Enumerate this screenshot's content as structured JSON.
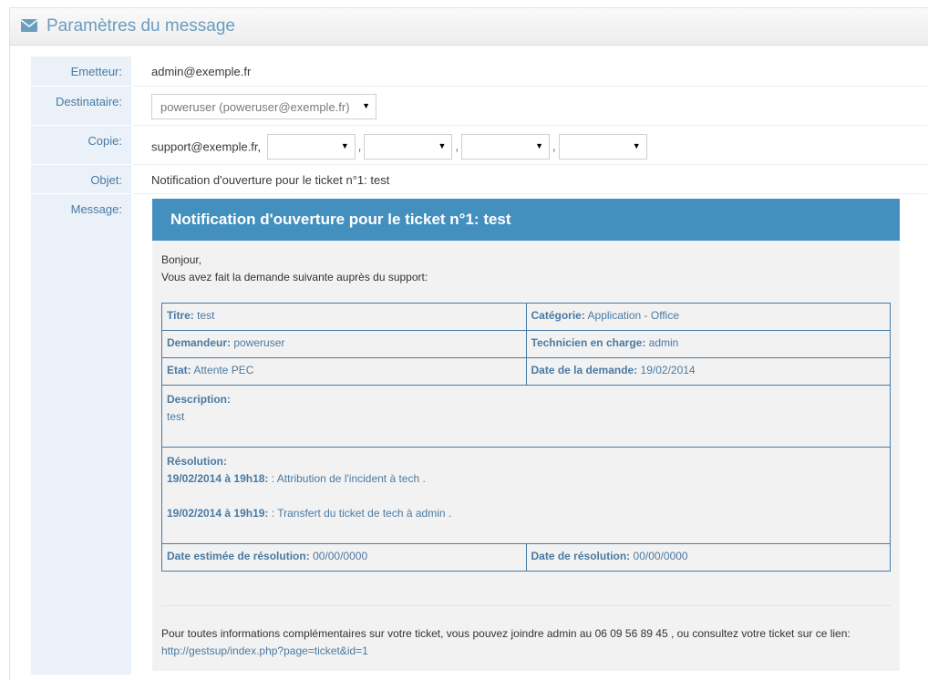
{
  "header": {
    "title": "Paramètres du message",
    "icon": "envelope-icon"
  },
  "form": {
    "sender_label": "Emetteur:",
    "sender_value": "admin@exemple.fr",
    "recipient_label": "Destinataire:",
    "recipient_value": "poweruser (poweruser@exemple.fr)",
    "copy_label": "Copie:",
    "copy_fixed": "support@exemple.fr,",
    "copy_separator": ",",
    "subject_label": "Objet:",
    "subject_value": "Notification d'ouverture pour le ticket n°1: test",
    "message_label": "Message:"
  },
  "message": {
    "heading": "Notification d'ouverture pour le ticket n°1: test",
    "greeting": "Bonjour,",
    "intro": "Vous avez fait la demande suivante auprès du support:",
    "title_label": "Titre:",
    "title_value": "test",
    "category_label": "Catégorie:",
    "category_value": "Application - Office",
    "requester_label": "Demandeur:",
    "requester_value": "poweruser",
    "technician_label": "Technicien en charge:",
    "technician_value": "admin",
    "state_label": "Etat:",
    "state_value": "Attente PEC",
    "request_date_label": "Date de la demande:",
    "request_date_value": "19/02/2014",
    "description_label": "Description:",
    "description_value": "test",
    "resolution_label": "Résolution:",
    "resolution_entries": [
      {
        "time": "19/02/2014 à 19h18:",
        "text": ": Attribution de l'incident à tech ."
      },
      {
        "time": "19/02/2014 à 19h19:",
        "text": ": Transfert du ticket de tech à admin ."
      }
    ],
    "estimated_label": "Date estimée de résolution:",
    "estimated_value": "00/00/0000",
    "resolution_date_label": "Date de résolution:",
    "resolution_date_value": "00/00/0000",
    "footer_text": "Pour toutes informations complémentaires sur votre ticket, vous pouvez joindre admin au 06 09 56 89 45 , ou consultez votre ticket sur ce lien:",
    "footer_link": "http://gestsup/index.php?page=ticket&id=1"
  },
  "colors": {
    "accent": "#4390bf",
    "label": "#4a7aa3",
    "label_bg": "#eaf1f8"
  }
}
